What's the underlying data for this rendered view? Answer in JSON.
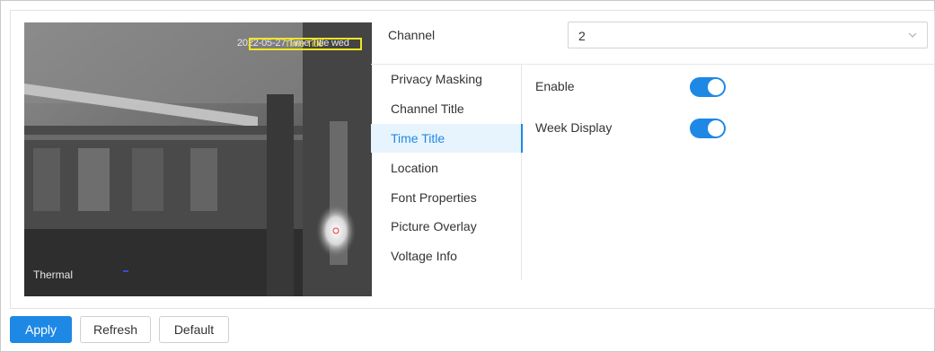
{
  "preview": {
    "osd_date": "2022-05-27 Time Title wed",
    "osd_box_label": "Time Title",
    "thermal_label": "Thermal"
  },
  "channel": {
    "label": "Channel",
    "value": "2"
  },
  "nav": {
    "items": [
      {
        "label": "Privacy Masking",
        "active": false
      },
      {
        "label": "Channel Title",
        "active": false
      },
      {
        "label": "Time Title",
        "active": true
      },
      {
        "label": "Location",
        "active": false
      },
      {
        "label": "Font Properties",
        "active": false
      },
      {
        "label": "Picture Overlay",
        "active": false
      },
      {
        "label": "Voltage Info",
        "active": false
      }
    ]
  },
  "settings": {
    "enable": {
      "label": "Enable",
      "on": true
    },
    "week_display": {
      "label": "Week Display",
      "on": true
    }
  },
  "buttons": {
    "apply": "Apply",
    "refresh": "Refresh",
    "default": "Default"
  },
  "colors": {
    "accent": "#1e88e5",
    "active_nav_bg": "#e8f4fd",
    "osd_box": "#f0e61e"
  },
  "icons": {
    "select_arrow": "chevron-down-icon"
  }
}
